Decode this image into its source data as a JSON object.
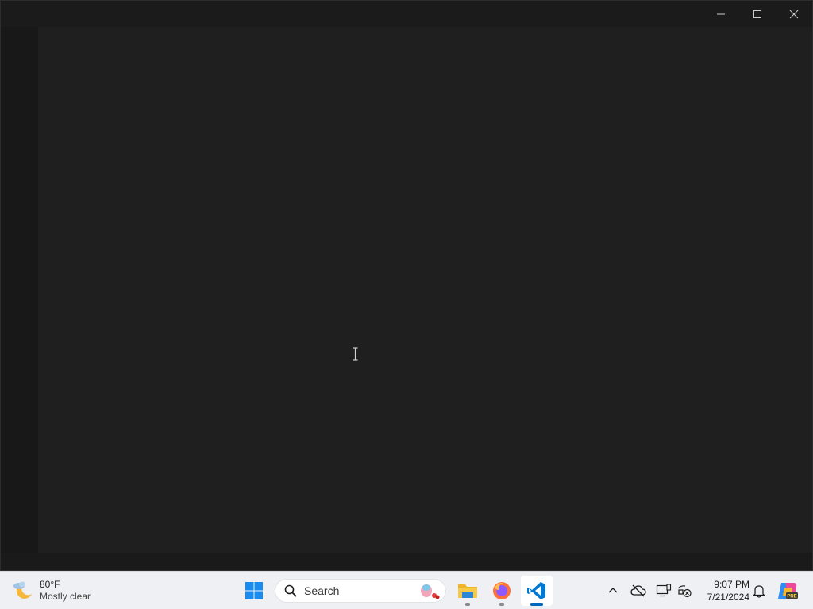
{
  "window": {
    "controls": {
      "minimize": "minimize-icon",
      "maximize": "maximize-icon",
      "close": "close-icon"
    }
  },
  "taskbar": {
    "weather": {
      "temperature": "80°F",
      "condition": "Mostly clear",
      "icon": "moon-cloud-icon"
    },
    "start_icon": "windows-start-icon",
    "search": {
      "placeholder": "Search"
    },
    "pinned_apps": [
      {
        "name": "File Explorer",
        "icon": "folder-icon",
        "running": true
      },
      {
        "name": "Firefox",
        "icon": "firefox-icon",
        "running": true
      },
      {
        "name": "Visual Studio Code",
        "icon": "vscode-icon",
        "running": true,
        "active": true
      }
    ],
    "tray": {
      "icons": [
        "chevron-up-icon",
        "onedrive-offline-icon",
        "display-icon",
        "network-disconnected-icon",
        "bell-icon",
        "copilot-pre-icon"
      ]
    },
    "clock": {
      "time": "9:07 PM",
      "date": "7/21/2024"
    }
  },
  "colors": {
    "editor_bg": "#1f1f1f",
    "sidebar_bg": "#181818",
    "taskbar_bg": "#eef0f3",
    "accent": "#0067c0"
  }
}
